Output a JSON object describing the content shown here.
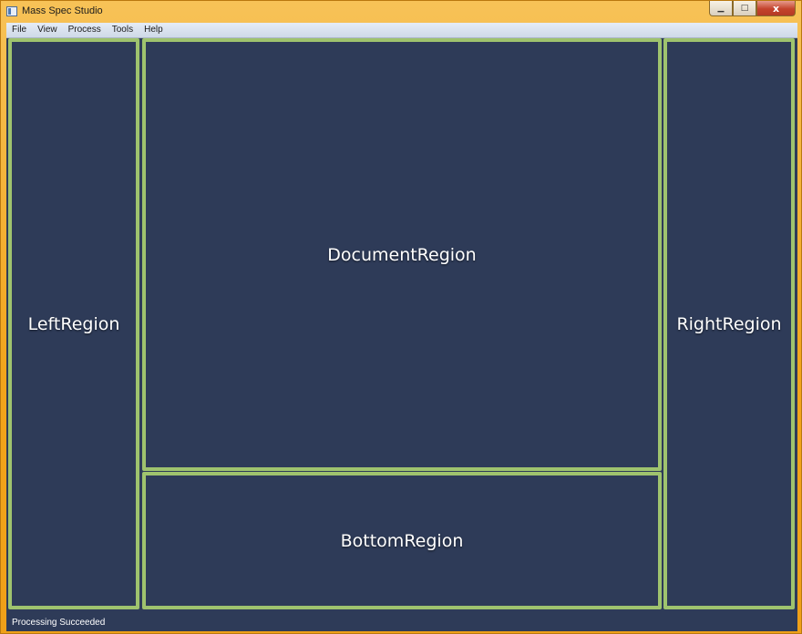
{
  "window": {
    "title": "Mass Spec Studio",
    "controls": {
      "minimize": "▁",
      "maximize": "□",
      "close": "x"
    }
  },
  "menu": {
    "items": [
      "File",
      "View",
      "Process",
      "Tools",
      "Help"
    ]
  },
  "regions": {
    "left": "LeftRegion",
    "document": "DocumentRegion",
    "bottom": "BottomRegion",
    "right": "RightRegion"
  },
  "status": {
    "text": "Processing Succeeded"
  },
  "colors": {
    "titlebar": "#f3a81c",
    "region_background": "#2e3b58",
    "region_border": "#9fc36e",
    "menubar": "#dbe3ef"
  },
  "icons": {
    "app": "app-window-icon"
  }
}
